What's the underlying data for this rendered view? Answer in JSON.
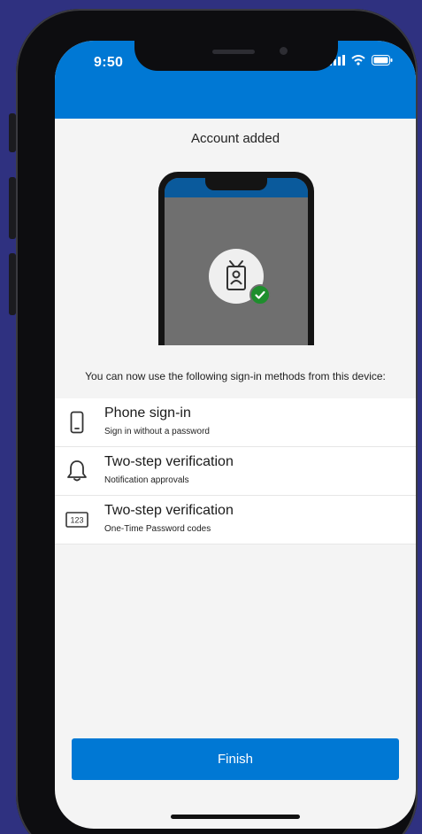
{
  "status_bar": {
    "time": "9:50",
    "icons": [
      "signal-icon",
      "wifi-icon",
      "battery-icon"
    ]
  },
  "screen": {
    "title": "Account added",
    "illustration": {
      "badge_icon": "id-badge-icon",
      "check_icon": "checkmark-icon"
    },
    "intro": "You can now use the following sign-in methods from this device:",
    "methods": [
      {
        "icon": "phone-icon",
        "title": "Phone sign-in",
        "subtitle": "Sign in without a password"
      },
      {
        "icon": "bell-icon",
        "title": "Two-step verification",
        "subtitle": "Notification approvals"
      },
      {
        "icon": "code-123-icon",
        "title": "Two-step verification",
        "subtitle": "One-Time Password codes",
        "icon_text": "123"
      }
    ],
    "finish_label": "Finish"
  },
  "colors": {
    "background": "#2f3180",
    "accent": "#0078d4",
    "screen_bg": "#f4f4f4",
    "success": "#1e8e2d"
  }
}
